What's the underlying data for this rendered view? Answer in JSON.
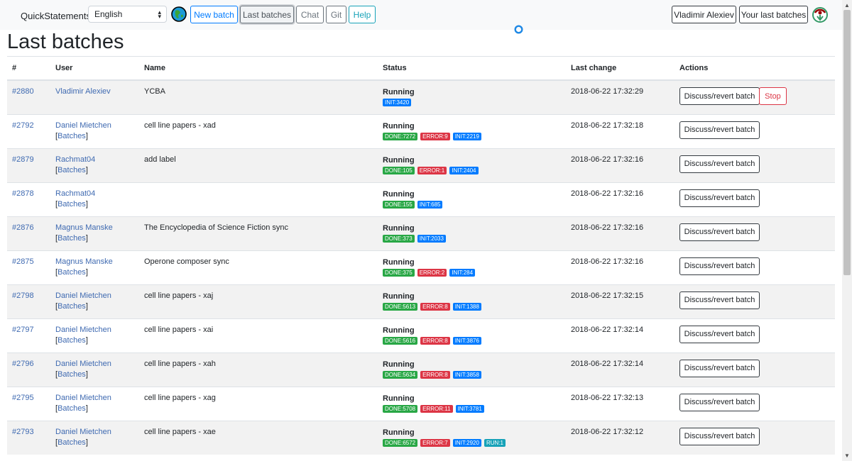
{
  "app": {
    "brand": "QuickStatements"
  },
  "navbar": {
    "language": "English",
    "buttons": {
      "new_batch": "New batch",
      "last_batches": "Last batches",
      "chat": "Chat",
      "git": "Git",
      "help": "Help"
    },
    "user_name": "Vladimir Alexiev",
    "your_last_batches": "Your last batches"
  },
  "page": {
    "title": "Last batches"
  },
  "table": {
    "headers": {
      "id": "#",
      "user": "User",
      "name": "Name",
      "status": "Status",
      "last_change": "Last change",
      "actions": "Actions"
    },
    "discuss_label": "Discuss/revert batch",
    "stop_label": "Stop",
    "batches_link": "Batches",
    "rows": [
      {
        "id": "#2880",
        "user": "Vladimir Alexiev",
        "batches": false,
        "name": "YCBA",
        "status": "Running",
        "badges": [
          {
            "t": "init",
            "l": "INIT:3420"
          }
        ],
        "last_change": "2018-06-22 17:32:29",
        "stop": true
      },
      {
        "id": "#2792",
        "user": "Daniel Mietchen",
        "batches": true,
        "name": "cell line papers - xad",
        "status": "Running",
        "badges": [
          {
            "t": "done",
            "l": "DONE:7272"
          },
          {
            "t": "error",
            "l": "ERROR:9"
          },
          {
            "t": "init",
            "l": "INIT:2219"
          }
        ],
        "last_change": "2018-06-22 17:32:18",
        "stop": false
      },
      {
        "id": "#2879",
        "user": "Rachmat04",
        "batches": true,
        "name": "add label",
        "status": "Running",
        "badges": [
          {
            "t": "done",
            "l": "DONE:105"
          },
          {
            "t": "error",
            "l": "ERROR:1"
          },
          {
            "t": "init",
            "l": "INIT:2404"
          }
        ],
        "last_change": "2018-06-22 17:32:16",
        "stop": false
      },
      {
        "id": "#2878",
        "user": "Rachmat04",
        "batches": true,
        "name": "",
        "status": "Running",
        "badges": [
          {
            "t": "done",
            "l": "DONE:155"
          },
          {
            "t": "init",
            "l": "INIT:685"
          }
        ],
        "last_change": "2018-06-22 17:32:16",
        "stop": false
      },
      {
        "id": "#2876",
        "user": "Magnus Manske",
        "batches": true,
        "name": "The Encyclopedia of Science Fiction sync",
        "status": "Running",
        "badges": [
          {
            "t": "done",
            "l": "DONE:373"
          },
          {
            "t": "init",
            "l": "INIT:2033"
          }
        ],
        "last_change": "2018-06-22 17:32:16",
        "stop": false
      },
      {
        "id": "#2875",
        "user": "Magnus Manske",
        "batches": true,
        "name": "Operone composer sync",
        "status": "Running",
        "badges": [
          {
            "t": "done",
            "l": "DONE:375"
          },
          {
            "t": "error",
            "l": "ERROR:2"
          },
          {
            "t": "init",
            "l": "INIT:284"
          }
        ],
        "last_change": "2018-06-22 17:32:16",
        "stop": false
      },
      {
        "id": "#2798",
        "user": "Daniel Mietchen",
        "batches": true,
        "name": "cell line papers - xaj",
        "status": "Running",
        "badges": [
          {
            "t": "done",
            "l": "DONE:5613"
          },
          {
            "t": "error",
            "l": "ERROR:8"
          },
          {
            "t": "init",
            "l": "INIT:1388"
          }
        ],
        "last_change": "2018-06-22 17:32:15",
        "stop": false
      },
      {
        "id": "#2797",
        "user": "Daniel Mietchen",
        "batches": true,
        "name": "cell line papers - xai",
        "status": "Running",
        "badges": [
          {
            "t": "done",
            "l": "DONE:5616"
          },
          {
            "t": "error",
            "l": "ERROR:8"
          },
          {
            "t": "init",
            "l": "INIT:3876"
          }
        ],
        "last_change": "2018-06-22 17:32:14",
        "stop": false
      },
      {
        "id": "#2796",
        "user": "Daniel Mietchen",
        "batches": true,
        "name": "cell line papers - xah",
        "status": "Running",
        "badges": [
          {
            "t": "done",
            "l": "DONE:5634"
          },
          {
            "t": "error",
            "l": "ERROR:8"
          },
          {
            "t": "init",
            "l": "INIT:3858"
          }
        ],
        "last_change": "2018-06-22 17:32:14",
        "stop": false
      },
      {
        "id": "#2795",
        "user": "Daniel Mietchen",
        "batches": true,
        "name": "cell line papers - xag",
        "status": "Running",
        "badges": [
          {
            "t": "done",
            "l": "DONE:5708"
          },
          {
            "t": "error",
            "l": "ERROR:11"
          },
          {
            "t": "init",
            "l": "INIT:3781"
          }
        ],
        "last_change": "2018-06-22 17:32:13",
        "stop": false
      },
      {
        "id": "#2793",
        "user": "Daniel Mietchen",
        "batches": true,
        "name": "cell line papers - xae",
        "status": "Running",
        "badges": [
          {
            "t": "done",
            "l": "DONE:6572"
          },
          {
            "t": "error",
            "l": "ERROR:7"
          },
          {
            "t": "init",
            "l": "INIT:2920"
          },
          {
            "t": "run",
            "l": "RUN:1"
          }
        ],
        "last_change": "2018-06-22 17:32:12",
        "stop": false
      }
    ]
  },
  "colors": {
    "link": "#3f6ab1",
    "done": "#28a745",
    "error": "#dc3545",
    "init": "#007bff",
    "run": "#17a2b8"
  }
}
